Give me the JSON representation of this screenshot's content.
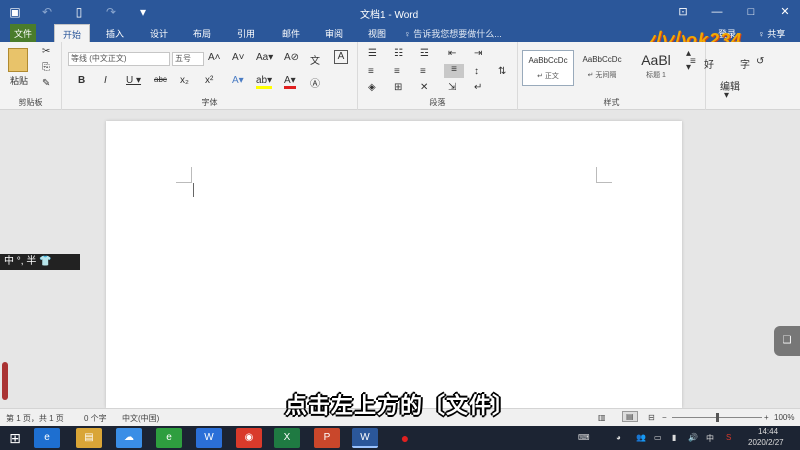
{
  "window": {
    "title": "文档1 - Word"
  },
  "qat": {
    "save": "▣",
    "undo": "↶",
    "new": "▯",
    "redo": "↷",
    "more": "▾"
  },
  "winctl": {
    "ribbon_opts": "⊡",
    "minimize": "—",
    "maximize": "□",
    "close": "✕"
  },
  "tabs": [
    "文件",
    "开始",
    "插入",
    "设计",
    "布局",
    "引用",
    "邮件",
    "审阅",
    "视图"
  ],
  "tell_me": "♀ 告诉我您想要做什么...",
  "login": "登录",
  "share": "♀ 共享",
  "logo": "小小ok234",
  "clipboard": {
    "paste": "粘贴",
    "label": "剪贴板"
  },
  "font": {
    "name": "等线 (中文正文)",
    "size": "五号",
    "label": "字体",
    "row1": [
      "A˄",
      "A˅",
      "Aa▾",
      "A⊘",
      "文",
      "A"
    ],
    "row2": [
      "B",
      "I",
      "U ▾",
      "abc",
      "x₂",
      "x²"
    ],
    "row3": [
      "A▾",
      "ab▾",
      "A▾",
      "Ⓐ"
    ]
  },
  "paragraph": {
    "label": "段落"
  },
  "styles": {
    "label": "样式",
    "items": [
      {
        "preview": "AaBbCcDc",
        "name": "↵ 正文"
      },
      {
        "preview": "AaBbCcDc",
        "name": "↵ 无间隔"
      },
      {
        "preview": "AaBl",
        "name": "标题 1"
      }
    ],
    "extra": [
      "≡",
      "好",
      "字",
      "↺"
    ]
  },
  "editing": {
    "label": "编辑"
  },
  "ime": "中 °, 半 👕",
  "side_tab": "❑",
  "subtitle": "点击左上方的〔文件〕",
  "status": {
    "page": "第 1 页，共 1 页",
    "words": "0 个字",
    "lang": "中文(中国)",
    "zoom": "100%",
    "zoom_minus": "−",
    "zoom_plus": "+",
    "zoom_level": 0.5
  },
  "taskbar": {
    "start": "⊞",
    "apps": [
      "e",
      "▤",
      "☁",
      "e",
      "W",
      "◉",
      "X",
      "P",
      "W",
      "●"
    ],
    "ime": "中",
    "clock": "14:44",
    "date": "2020/2/27"
  },
  "colors": {
    "ribbon_blue": "#2b579a",
    "file_green": "#4a7c2b",
    "logo_gold": "#f2a900"
  }
}
